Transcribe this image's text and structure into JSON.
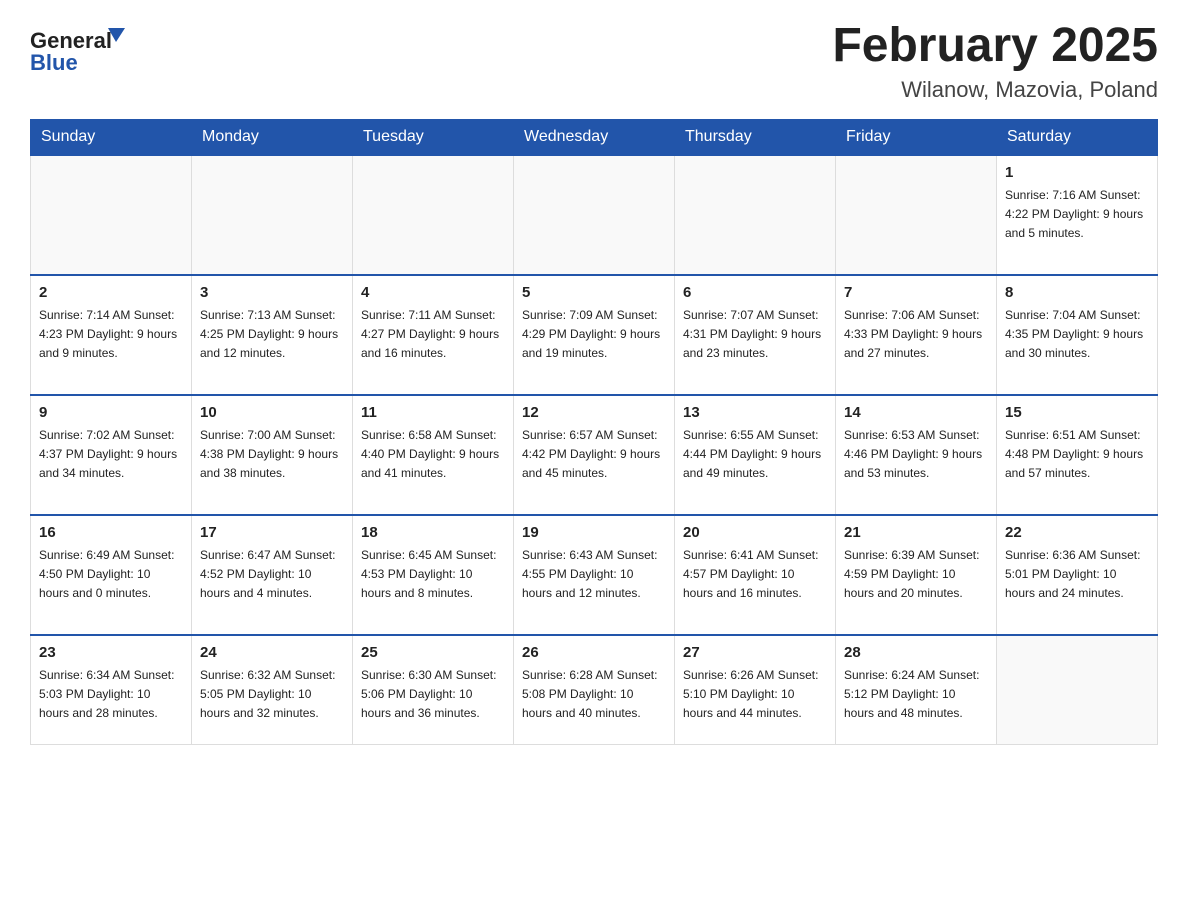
{
  "header": {
    "logo_general": "General",
    "logo_blue": "Blue",
    "title": "February 2025",
    "subtitle": "Wilanow, Mazovia, Poland"
  },
  "weekdays": [
    "Sunday",
    "Monday",
    "Tuesday",
    "Wednesday",
    "Thursday",
    "Friday",
    "Saturday"
  ],
  "weeks": [
    [
      {
        "day": "",
        "info": ""
      },
      {
        "day": "",
        "info": ""
      },
      {
        "day": "",
        "info": ""
      },
      {
        "day": "",
        "info": ""
      },
      {
        "day": "",
        "info": ""
      },
      {
        "day": "",
        "info": ""
      },
      {
        "day": "1",
        "info": "Sunrise: 7:16 AM\nSunset: 4:22 PM\nDaylight: 9 hours\nand 5 minutes."
      }
    ],
    [
      {
        "day": "2",
        "info": "Sunrise: 7:14 AM\nSunset: 4:23 PM\nDaylight: 9 hours\nand 9 minutes."
      },
      {
        "day": "3",
        "info": "Sunrise: 7:13 AM\nSunset: 4:25 PM\nDaylight: 9 hours\nand 12 minutes."
      },
      {
        "day": "4",
        "info": "Sunrise: 7:11 AM\nSunset: 4:27 PM\nDaylight: 9 hours\nand 16 minutes."
      },
      {
        "day": "5",
        "info": "Sunrise: 7:09 AM\nSunset: 4:29 PM\nDaylight: 9 hours\nand 19 minutes."
      },
      {
        "day": "6",
        "info": "Sunrise: 7:07 AM\nSunset: 4:31 PM\nDaylight: 9 hours\nand 23 minutes."
      },
      {
        "day": "7",
        "info": "Sunrise: 7:06 AM\nSunset: 4:33 PM\nDaylight: 9 hours\nand 27 minutes."
      },
      {
        "day": "8",
        "info": "Sunrise: 7:04 AM\nSunset: 4:35 PM\nDaylight: 9 hours\nand 30 minutes."
      }
    ],
    [
      {
        "day": "9",
        "info": "Sunrise: 7:02 AM\nSunset: 4:37 PM\nDaylight: 9 hours\nand 34 minutes."
      },
      {
        "day": "10",
        "info": "Sunrise: 7:00 AM\nSunset: 4:38 PM\nDaylight: 9 hours\nand 38 minutes."
      },
      {
        "day": "11",
        "info": "Sunrise: 6:58 AM\nSunset: 4:40 PM\nDaylight: 9 hours\nand 41 minutes."
      },
      {
        "day": "12",
        "info": "Sunrise: 6:57 AM\nSunset: 4:42 PM\nDaylight: 9 hours\nand 45 minutes."
      },
      {
        "day": "13",
        "info": "Sunrise: 6:55 AM\nSunset: 4:44 PM\nDaylight: 9 hours\nand 49 minutes."
      },
      {
        "day": "14",
        "info": "Sunrise: 6:53 AM\nSunset: 4:46 PM\nDaylight: 9 hours\nand 53 minutes."
      },
      {
        "day": "15",
        "info": "Sunrise: 6:51 AM\nSunset: 4:48 PM\nDaylight: 9 hours\nand 57 minutes."
      }
    ],
    [
      {
        "day": "16",
        "info": "Sunrise: 6:49 AM\nSunset: 4:50 PM\nDaylight: 10 hours\nand 0 minutes."
      },
      {
        "day": "17",
        "info": "Sunrise: 6:47 AM\nSunset: 4:52 PM\nDaylight: 10 hours\nand 4 minutes."
      },
      {
        "day": "18",
        "info": "Sunrise: 6:45 AM\nSunset: 4:53 PM\nDaylight: 10 hours\nand 8 minutes."
      },
      {
        "day": "19",
        "info": "Sunrise: 6:43 AM\nSunset: 4:55 PM\nDaylight: 10 hours\nand 12 minutes."
      },
      {
        "day": "20",
        "info": "Sunrise: 6:41 AM\nSunset: 4:57 PM\nDaylight: 10 hours\nand 16 minutes."
      },
      {
        "day": "21",
        "info": "Sunrise: 6:39 AM\nSunset: 4:59 PM\nDaylight: 10 hours\nand 20 minutes."
      },
      {
        "day": "22",
        "info": "Sunrise: 6:36 AM\nSunset: 5:01 PM\nDaylight: 10 hours\nand 24 minutes."
      }
    ],
    [
      {
        "day": "23",
        "info": "Sunrise: 6:34 AM\nSunset: 5:03 PM\nDaylight: 10 hours\nand 28 minutes."
      },
      {
        "day": "24",
        "info": "Sunrise: 6:32 AM\nSunset: 5:05 PM\nDaylight: 10 hours\nand 32 minutes."
      },
      {
        "day": "25",
        "info": "Sunrise: 6:30 AM\nSunset: 5:06 PM\nDaylight: 10 hours\nand 36 minutes."
      },
      {
        "day": "26",
        "info": "Sunrise: 6:28 AM\nSunset: 5:08 PM\nDaylight: 10 hours\nand 40 minutes."
      },
      {
        "day": "27",
        "info": "Sunrise: 6:26 AM\nSunset: 5:10 PM\nDaylight: 10 hours\nand 44 minutes."
      },
      {
        "day": "28",
        "info": "Sunrise: 6:24 AM\nSunset: 5:12 PM\nDaylight: 10 hours\nand 48 minutes."
      },
      {
        "day": "",
        "info": ""
      }
    ]
  ]
}
